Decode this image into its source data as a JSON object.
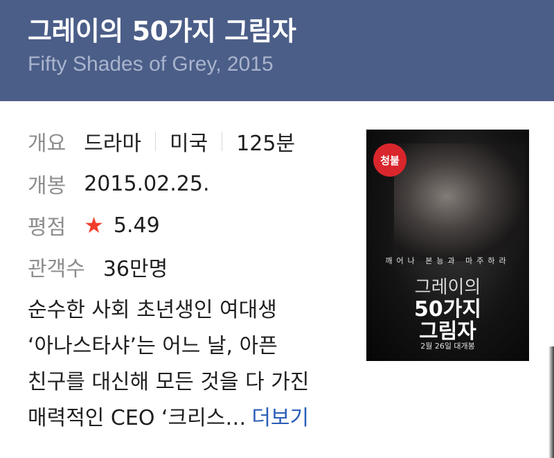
{
  "header": {
    "title": "그레이의 50가지 그림자",
    "subtitle": "Fifty Shades of Grey, 2015",
    "background_color": "#4b5e88"
  },
  "info": {
    "overview": {
      "label": "개요",
      "genre": "드라마",
      "country": "미국",
      "runtime": "125분"
    },
    "release": {
      "label": "개봉",
      "value": "2015.02.25."
    },
    "rating": {
      "label": "평점",
      "icon": "star-icon",
      "value": "5.49",
      "star_color": "#f23d2c"
    },
    "audience": {
      "label": "관객수",
      "value": "36만명"
    }
  },
  "description": {
    "lines": [
      "순수한 사회 초년생인 여대생",
      "‘아나스타샤’는 어느 날, 아픈",
      "친구를 대신해 모든 것을 다 가진",
      "매력적인 CEO ‘크리스…"
    ],
    "more_label": "더보기",
    "more_color": "#2a5db8"
  },
  "poster": {
    "rating_badge": "청불",
    "tagline": "깨어나 본능과 마주하라",
    "title_line1": "그레이의",
    "title_line2": "50가지",
    "title_line3": "그림자",
    "release_text": "2월 26일 대개봉"
  }
}
